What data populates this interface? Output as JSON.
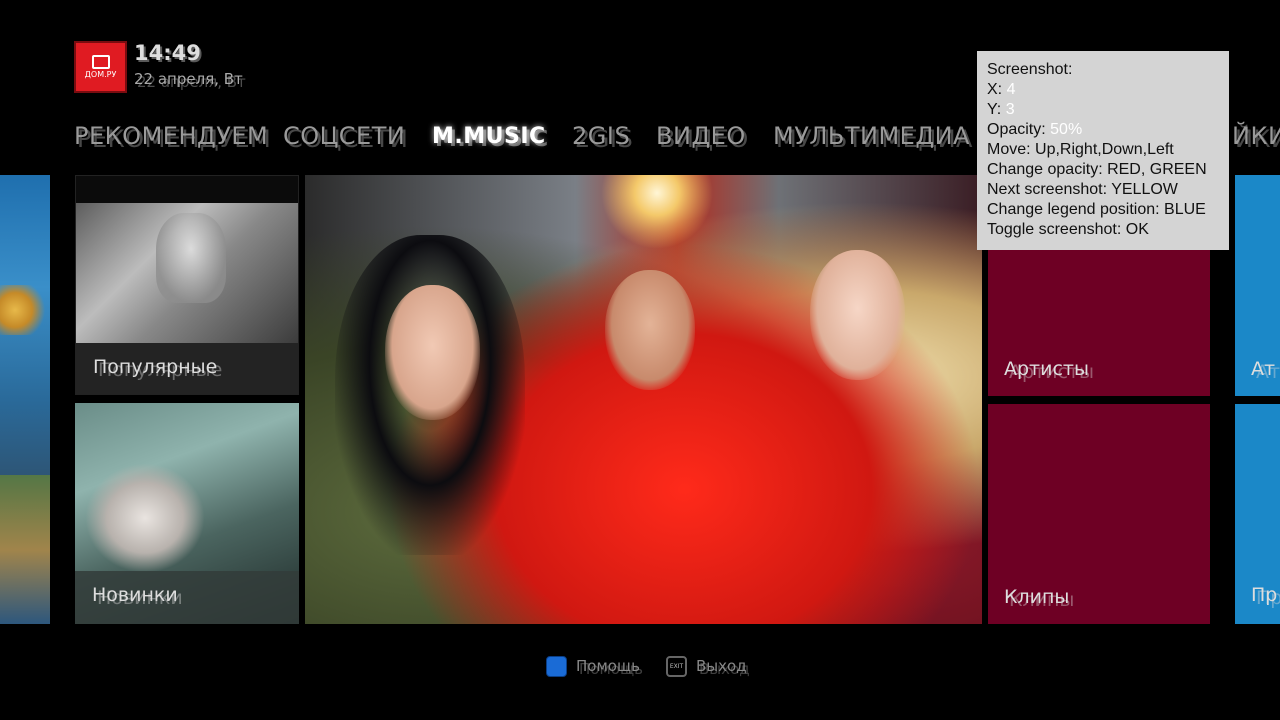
{
  "header": {
    "logo_label": "ДОМ.РУ",
    "time": "14:49",
    "date": "22 апреля, Вт"
  },
  "tabs": [
    {
      "label": "РЕКОМЕНДУЕМ"
    },
    {
      "label": "СОЦСЕТИ"
    },
    {
      "label": "M.MUSIC",
      "active": true
    },
    {
      "label": "2GIS"
    },
    {
      "label": "ВИДЕО"
    },
    {
      "label": "МУЛЬТИМЕДИА"
    },
    {
      "label": "ЙКИ"
    }
  ],
  "tiles": {
    "popular": "Популярные",
    "new": "Новинки",
    "artists": "Артисты",
    "clips": "Клипы",
    "right_edge_top": "Ат",
    "right_edge_bottom": "Пр"
  },
  "footer": {
    "help_label": "Помощь",
    "exit_icon_text": "EXIT",
    "exit_label": "Выход"
  },
  "legend": {
    "title": "Screenshot:",
    "x_label": "X:",
    "x_value": "4",
    "y_label": "Y:",
    "y_value": "3",
    "opacity_label": "Opacity:",
    "opacity_value": "50%",
    "move": "Move: Up,Right,Down,Left",
    "change_opacity": "Change opacity: RED, GREEN",
    "next": "Next screenshot: YELLOW",
    "legend_position": "Change legend position: BLUE",
    "toggle": "Toggle screenshot: OK"
  },
  "colors": {
    "brand_red": "#e01b22",
    "tile_maroon": "#6e0024",
    "tile_blue": "#1b88c8",
    "help_button_blue": "#1a6bd6"
  }
}
